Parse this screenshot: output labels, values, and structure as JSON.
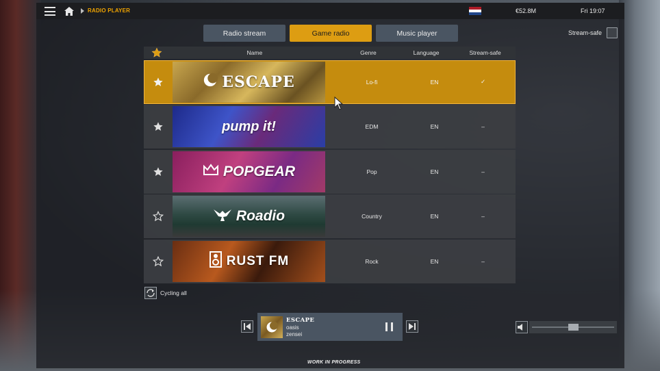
{
  "topbar": {
    "breadcrumb": "RADIO PLAYER",
    "money": "€52.8M",
    "time": "Fri 19:07",
    "flag_colors": [
      "#ae1c28",
      "#ffffff",
      "#21468b"
    ],
    "icons": {
      "menu": "hamburger-icon",
      "home": "home-icon"
    }
  },
  "tabs": [
    {
      "label": "Radio stream",
      "active": false
    },
    {
      "label": "Game radio",
      "active": true
    },
    {
      "label": "Music player",
      "active": false
    }
  ],
  "stream_safe_filter": {
    "label": "Stream-safe",
    "checked": false
  },
  "table": {
    "headers": {
      "name": "Name",
      "genre": "Genre",
      "language": "Language",
      "stream_safe": "Stream-safe"
    },
    "rows": [
      {
        "name": "ESCAPE",
        "genre": "Lo-fi",
        "language": "EN",
        "stream_safe": "✓",
        "favorite": true,
        "selected": true
      },
      {
        "name": "pump it!",
        "genre": "EDM",
        "language": "EN",
        "stream_safe": "–",
        "favorite": true,
        "selected": false
      },
      {
        "name": "POPGEAR",
        "genre": "Pop",
        "language": "EN",
        "stream_safe": "–",
        "favorite": true,
        "selected": false
      },
      {
        "name": "Roadio",
        "genre": "Country",
        "language": "EN",
        "stream_safe": "–",
        "favorite": false,
        "selected": false
      },
      {
        "name": "RUST FM",
        "genre": "Rock",
        "language": "EN",
        "stream_safe": "–",
        "favorite": false,
        "selected": false
      }
    ]
  },
  "cycling": {
    "label": "Cycling all"
  },
  "player": {
    "station": "ESCAPE",
    "song": "oasis",
    "artist": "zensei",
    "volume_fraction": 0.5
  },
  "footer": {
    "wip": "WORK IN PROGRESS"
  },
  "colors": {
    "accent": "#dd9d12",
    "tab": "#4a5562",
    "selected_row": "#c58c0e"
  }
}
